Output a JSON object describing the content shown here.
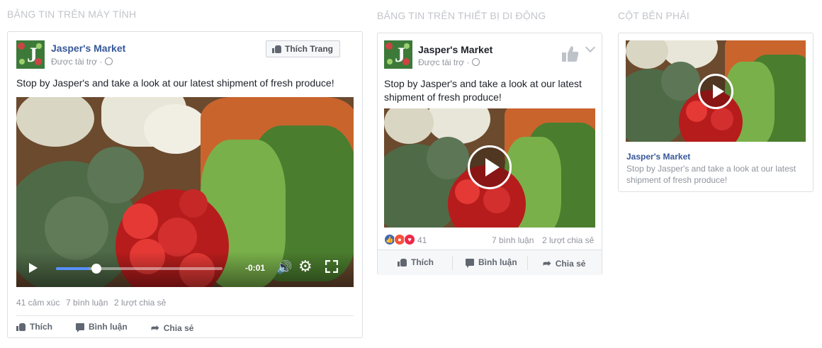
{
  "sections": {
    "desktop": "BẢNG TIN TRÊN MÁY TÍNH",
    "mobile": "BẢNG TIN TRÊN THIẾT BỊ DI ĐỘNG",
    "right": "CỘT BÊN PHẢI"
  },
  "post": {
    "page_name": "Jasper's Market",
    "sponsored": "Được tài trợ ·",
    "text": "Stop by Jasper's and take a look at our latest shipment of fresh produce!",
    "like_page_label": "Thích Trang"
  },
  "desktop": {
    "video_time": "-0:01",
    "video_progress": 0.2,
    "stats": {
      "reactions": "41 cảm xúc",
      "comments": "7 bình luận",
      "shares": "2 lượt chia sẻ"
    },
    "actions": {
      "like": "Thích",
      "comment": "Bình luận",
      "share": "Chia sẻ"
    }
  },
  "mobile": {
    "text": "Stop by Jasper's and take a look at our latest shipment of fresh produce!",
    "reaction_count": "41",
    "comments": "7 bình luận",
    "shares": "2 lượt chia sẻ",
    "actions": {
      "like": "Thích",
      "comment": "Bình luận",
      "share": "Chia sẻ"
    }
  },
  "right_column": {
    "title": "Jasper's Market",
    "desc": "Stop by Jasper's and take a look at our latest shipment of fresh produce!"
  },
  "colors": {
    "brand_link": "#365899",
    "muted": "#90949c",
    "like_blue": "#4267b2",
    "angry": "#f5533d",
    "love": "#f0284a"
  }
}
